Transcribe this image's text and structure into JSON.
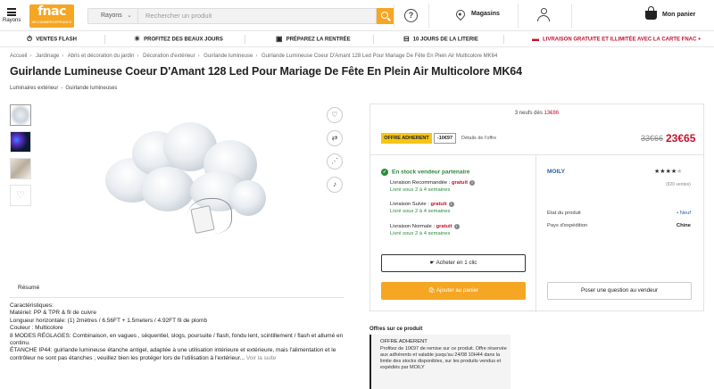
{
  "header": {
    "menu_label": "Rayons",
    "logo_text": "fnac",
    "logo_sub": "#ECOMMERCEFRANCE",
    "rayons_label": "Rayons",
    "search_placeholder": "Rechercher un produit",
    "stores_label": "Magasins",
    "cart_label": "Mon panier"
  },
  "promo": [
    {
      "icon": "flash-icon",
      "glyph": "⏱",
      "label": "VENTES FLASH"
    },
    {
      "icon": "sun-icon",
      "glyph": "☀",
      "label": "PROFITEZ DES BEAUX JOURS"
    },
    {
      "icon": "school-bag-icon",
      "glyph": "▣",
      "label": "PRÉPAREZ LA RENTRÉE"
    },
    {
      "icon": "bed-icon",
      "glyph": "⊟",
      "label": "10 JOURS DE LA LITERIE"
    },
    {
      "icon": "card-icon",
      "glyph": "▬",
      "label": "LIVRAISON GRATUITE ET ILLIMITÉE AVEC LA CARTE FNAC +"
    }
  ],
  "breadcrumb": [
    "Accueil",
    "Jardinage",
    "Abris et décoration du jardin",
    "Décoration d'extérieur",
    "Guirlande lumineuse",
    "Guirlande Lumineuse Coeur D'Amant 128 Led Pour Mariage De Fête En Plein Air Multicolore MK64"
  ],
  "product": {
    "title": "Guirlande Lumineuse Coeur D'Amant 128 Led Pour Mariage De Fête En Plein Air Multicolore MK64",
    "subcats": [
      "Luminaires extérieur",
      "Guirlande lumineuses"
    ]
  },
  "tabs": {
    "resume": "Résumé"
  },
  "description": {
    "lines": [
      "Caractéristiques:",
      "Matériel: PP & TPR & fil de cuivre",
      "Longueur horizontale: (1) 2mètres / 6.56FT + 1.5meters / 4.92FT fil de plomb",
      "Couleur :    Multicolore",
      "8 MODES RÉGLAGES: Combinaison, en vagues , séquentiel, slogs, poursuite / flash, fondu lent, scintillement / flash et allumé en continu.",
      "ÉTANCHE IP44: guirlande lumineuse étanche antigel, adaptée à une utilisation intérieure et extérieure, mais l'alimentation et le contrôleur ne sont pas étanches , veuillez bien les protéger lors de l'utilisation à l'extérieur..."
    ],
    "more": "Voir la suite"
  },
  "buybox": {
    "new_count": "3 neufs dès",
    "new_from": "13€86",
    "adherent_badge": "OFFRE ADHERENT",
    "discount": "-10€97",
    "details_link": "Détails de l'offre",
    "old_price": "33€66",
    "price": "23€65",
    "stock": "En stock vendeur partenaire",
    "deliveries": [
      {
        "label": "Livraison Recommandée :",
        "free": "gratuit",
        "time": "Livré sous 2 à 4 semaines"
      },
      {
        "label": "Livraison Suivie :",
        "free": "gratuit",
        "time": "Livré sous 2 à 4 semaines"
      },
      {
        "label": "Livraison Normale :",
        "free": "gratuit",
        "time": "Livré sous 2 à 4 semaines"
      }
    ],
    "seller": "MOILY",
    "rating": 4.5,
    "votes": "(920 ventes)",
    "state_label": "État du produit",
    "state_value": "• Neuf",
    "ship_label": "Pays d'expédition",
    "ship_value": "Chine",
    "btn_1clic": "Acheter en 1 clic",
    "btn_add": "Ajouter au panier",
    "btn_ask": "Poser une question au vendeur"
  },
  "offers": {
    "title": "Offres sur ce produit",
    "box_title": "OFFRE ADHERENT",
    "box_text": "Profitez de 10€97 de remise sur ce produit. Offre réservée aux adhérents et valable jusqu'au 24/08 10H44 dans la limite des stocks disponibles, sur les produits vendus et expédiés par MOILY"
  },
  "colors": {
    "brand": "#f5a623",
    "price_red": "#c4122f",
    "stock_green": "#2a8a3c",
    "link_blue": "#2b5da8"
  }
}
